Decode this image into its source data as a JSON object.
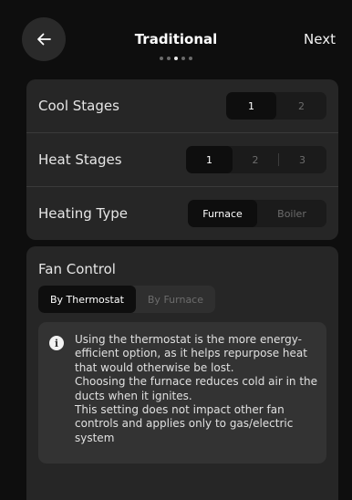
{
  "header": {
    "title": "Traditional",
    "next_label": "Next",
    "back_icon": "arrow-left-icon",
    "step_total": 5,
    "step_current": 3
  },
  "settings": {
    "cool_stages": {
      "label": "Cool Stages",
      "options": [
        "1",
        "2"
      ],
      "selected": "1"
    },
    "heat_stages": {
      "label": "Heat Stages",
      "options": [
        "1",
        "2",
        "3"
      ],
      "selected": "1"
    },
    "heating_type": {
      "label": "Heating Type",
      "options": [
        "Furnace",
        "Boiler"
      ],
      "selected": "Furnace"
    }
  },
  "fan_control": {
    "title": "Fan Control",
    "options": [
      "By Thermostat",
      "By Furnace"
    ],
    "selected": "By Thermostat",
    "info_icon": "info-icon",
    "info_lines": [
      "Using the thermostat is the more energy-efficient option, as it helps repurpose heat that would otherwise be lost.",
      "Choosing the furnace reduces cold air in the ducts when it ignites.",
      "This setting does not impact other fan controls and applies only to gas/electric system"
    ]
  },
  "colors": {
    "background": "#0e0e0e",
    "card": "#262626",
    "info_box": "#333333",
    "selected_segment": "#0e0e0e"
  }
}
